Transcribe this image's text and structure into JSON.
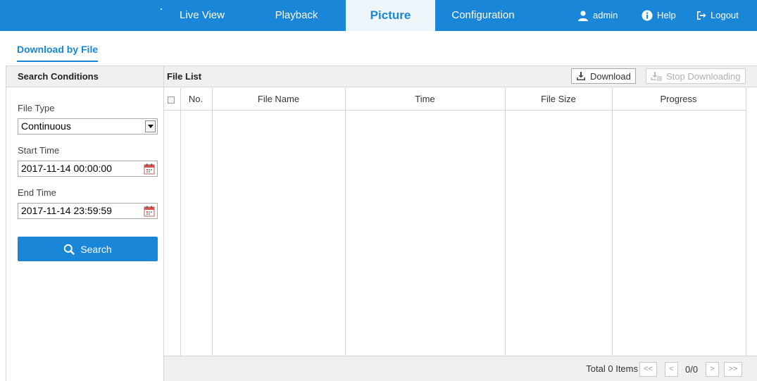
{
  "topnav": {
    "tabs": [
      {
        "label": "Live View"
      },
      {
        "label": "Playback"
      },
      {
        "label": "Picture"
      },
      {
        "label": "Configuration"
      }
    ],
    "user": "admin",
    "help": "Help",
    "logout": "Logout"
  },
  "subnav": {
    "tab": "Download by File"
  },
  "search": {
    "title": "Search Conditions",
    "file_type_label": "File Type",
    "file_type_value": "Continuous",
    "start_label": "Start Time",
    "start_value": "2017-11-14 00:00:00",
    "end_label": "End Time",
    "end_value": "2017-11-14 23:59:59",
    "button": "Search"
  },
  "filelist": {
    "title": "File List",
    "download": "Download",
    "stop": "Stop Downloading",
    "columns": [
      "No.",
      "File Name",
      "Time",
      "File Size",
      "Progress"
    ],
    "total": "Total 0 Items",
    "pager": {
      "first": "<<",
      "prev": "<",
      "page": "0/0",
      "next": ">",
      "last": ">>"
    }
  },
  "colors": {
    "accent": "#1a86d8",
    "header_bg": "#f0f0f0",
    "border": "#d5d5d5"
  }
}
